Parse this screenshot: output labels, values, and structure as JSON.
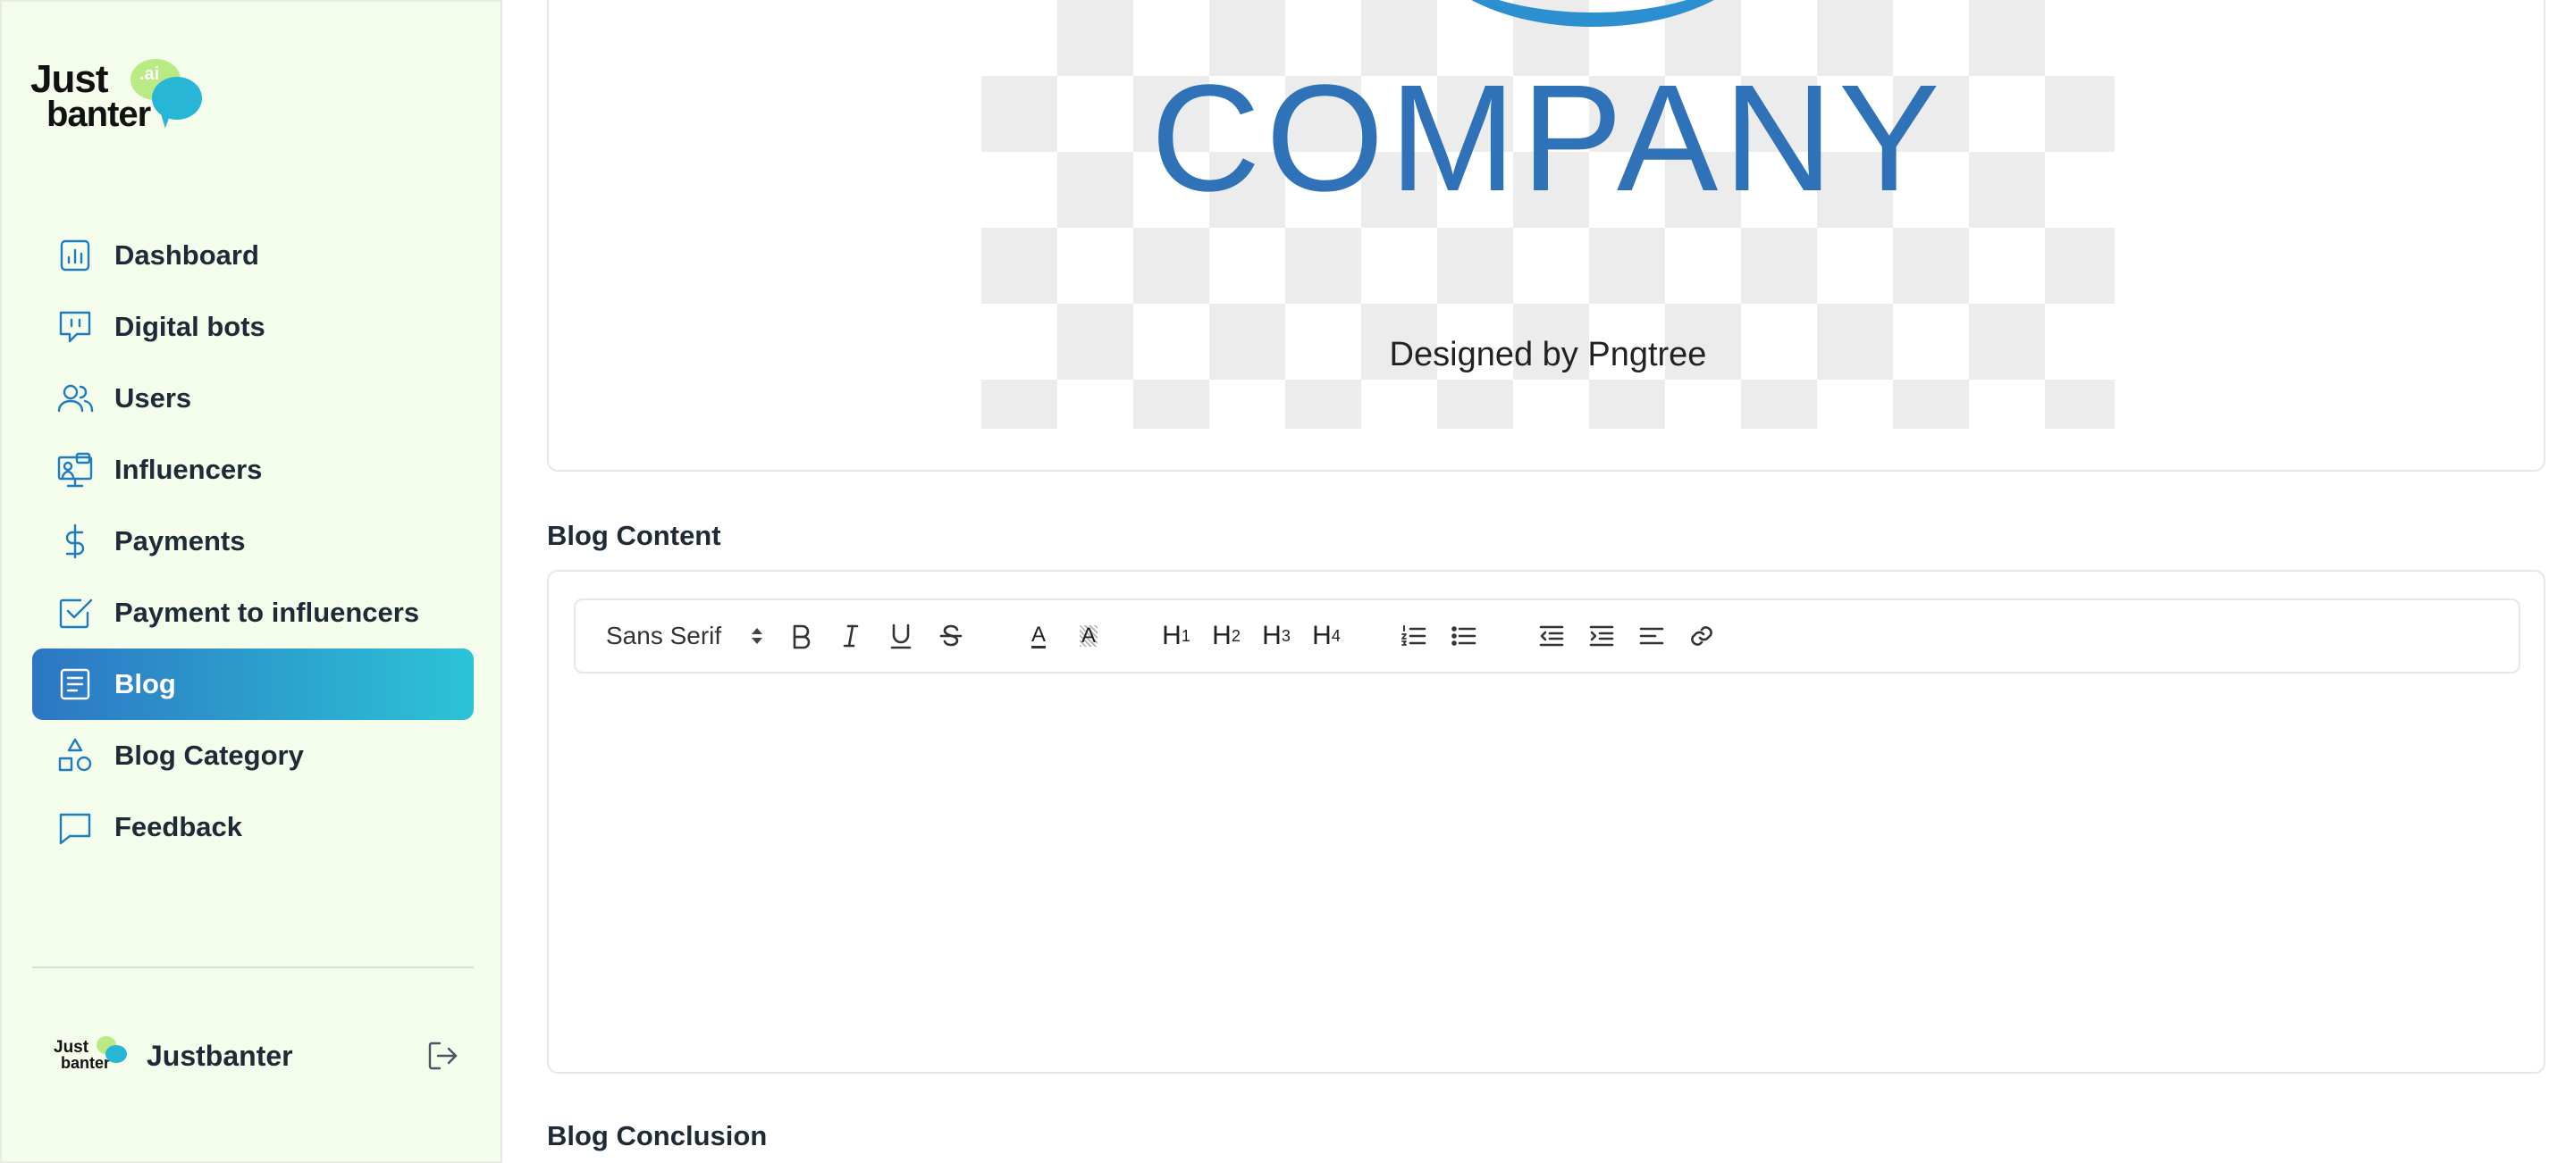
{
  "brand": {
    "logo_line1": "Just",
    "logo_line2": "banter",
    "logo_badge": ".ai"
  },
  "sidebar": {
    "items": [
      {
        "label": "Dashboard",
        "icon": "dashboard-icon",
        "active": false
      },
      {
        "label": "Digital bots",
        "icon": "chat-bot-icon",
        "active": false
      },
      {
        "label": "Users",
        "icon": "users-icon",
        "active": false
      },
      {
        "label": "Influencers",
        "icon": "influencers-icon",
        "active": false
      },
      {
        "label": "Payments",
        "icon": "dollar-icon",
        "active": false
      },
      {
        "label": "Payment to influencers",
        "icon": "checkbox-icon",
        "active": false
      },
      {
        "label": "Blog",
        "icon": "document-icon",
        "active": true
      },
      {
        "label": "Blog Category",
        "icon": "shapes-icon",
        "active": false
      },
      {
        "label": "Feedback",
        "icon": "message-icon",
        "active": false
      }
    ],
    "user": {
      "name": "Justbanter",
      "avatar_line1": "Just",
      "avatar_line2": "banter",
      "logout_icon": "logout-icon"
    }
  },
  "colors": {
    "sidebar_bg": "#f4fcec",
    "active_gradient_start": "#2d76c3",
    "active_gradient_end": "#2cc3d6",
    "icon_blue": "#1f7bc0"
  },
  "main": {
    "image_preview": {
      "logo_text": "COMPANY",
      "credit_text": "Designed by Pngtree"
    },
    "blog_content_label": "Blog Content",
    "blog_conclusion_label": "Blog Conclusion",
    "editor": {
      "font_select_value": "Sans Serif",
      "headers": [
        {
          "h": "H",
          "n": "1"
        },
        {
          "h": "H",
          "n": "2"
        },
        {
          "h": "H",
          "n": "3"
        },
        {
          "h": "H",
          "n": "4"
        }
      ],
      "text_color_glyph": "A",
      "background_color_glyph": "A"
    }
  }
}
